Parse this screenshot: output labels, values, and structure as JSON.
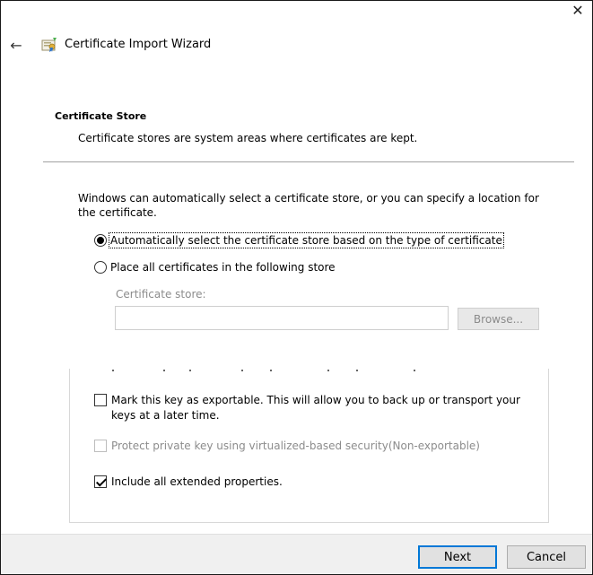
{
  "window": {
    "title": "Certificate Import Wizard",
    "close_glyph": "✕",
    "back_glyph": "←"
  },
  "header": {
    "section_title": "Certificate Store",
    "section_desc": "Certificate stores are system areas where certificates are kept."
  },
  "body": {
    "intro": "Windows can automatically select a certificate store, or you can specify a location for the certificate.",
    "radio_auto": {
      "label": "Automatically select the certificate store based on the type of certificate",
      "checked": true
    },
    "radio_manual": {
      "label": "Place all certificates in the following store",
      "checked": false
    },
    "store_label": "Certificate store:",
    "store_value": "",
    "browse_label": "Browse..."
  },
  "options": {
    "exportable": {
      "label": "Mark this key as exportable. This will allow you to back up or transport your keys at a later time.",
      "checked": false
    },
    "vbs": {
      "label": "Protect private key using virtualized-based security(Non-exportable)",
      "checked": false,
      "disabled": true
    },
    "extended": {
      "label": "Include all extended properties.",
      "checked": true
    }
  },
  "footer": {
    "next_label": "Next",
    "cancel_label": "Cancel"
  },
  "colors": {
    "accent": "#0078d7",
    "disabled_text": "#8c8c8c",
    "footer_bg": "#f0f0f0"
  }
}
